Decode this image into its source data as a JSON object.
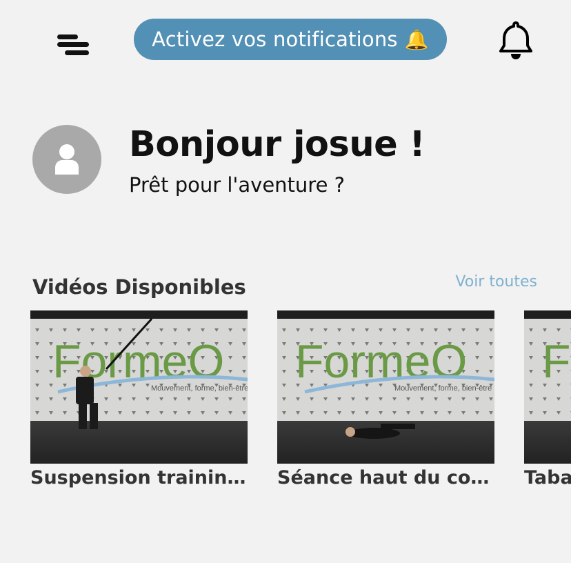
{
  "header": {
    "notification_banner": "Activez vos notifications",
    "banner_emoji": "🔔",
    "menu_icon": "menu-lines-icon",
    "bell_icon": "bell-icon"
  },
  "profile": {
    "greeting": "Bonjour josue !",
    "subtitle": "Prêt pour l'aventure ?",
    "avatar_icon": "user-placeholder-icon"
  },
  "videos_section": {
    "title": "Vidéos Disponibles",
    "see_all": "Voir toutes",
    "items": [
      {
        "title": "Suspension training:..."
      },
      {
        "title": "Séance haut du cor..."
      },
      {
        "title": "Taba"
      }
    ],
    "thumbnail_logo": "FormeO",
    "thumbnail_tagline": "Mouvement, forme, bien-être"
  },
  "colors": {
    "background": "#f2f2f2",
    "banner": "#5390b5",
    "link": "#7fb1cf",
    "avatar": "#a9a9a9"
  }
}
